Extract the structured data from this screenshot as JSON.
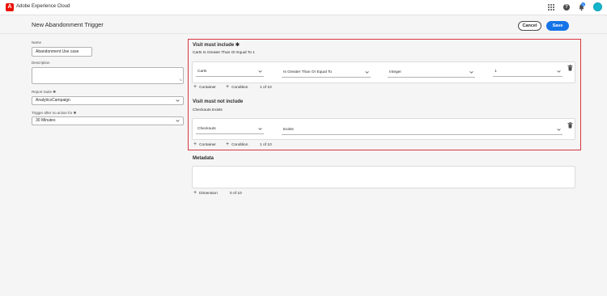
{
  "app": {
    "title": "Adobe Experience Cloud",
    "logo_letter": "A",
    "notification_count": "1",
    "help_glyph": "?",
    "accent_color": "#1473e6",
    "brand_color": "#eb1000",
    "highlight_color": "#d7373f"
  },
  "header": {
    "page_title": "New Abandonment Trigger",
    "cancel_label": "Cancel",
    "save_label": "Save"
  },
  "form": {
    "name_label": "Name",
    "name_value": "Abandonment Use case",
    "description_label": "Description",
    "description_value": "",
    "report_suite_label": "Report Suite ✱",
    "report_suite_value": "AnalyticsCampaign",
    "trigger_label": "Trigger after no action for ✱",
    "trigger_value": "30 Minutes"
  },
  "include": {
    "title": "Visit must include ✱",
    "summary": "Carts Is Greater Than Or Equal To 1",
    "dimension": "Carts",
    "operator": "Is Greater Than Or Equal To",
    "type": "Integer",
    "value": "1",
    "container_label": "Container",
    "condition_label": "Condition",
    "count": "1 of 10"
  },
  "exclude": {
    "title": "Visit must not include",
    "summary": "Checkouts Exists",
    "dimension": "Checkouts",
    "operator": "Exists",
    "container_label": "Container",
    "condition_label": "Condition",
    "count": "1 of 10"
  },
  "metadata": {
    "title": "Metadata",
    "dimension_label": "Dimension",
    "count": "0 of 10"
  }
}
